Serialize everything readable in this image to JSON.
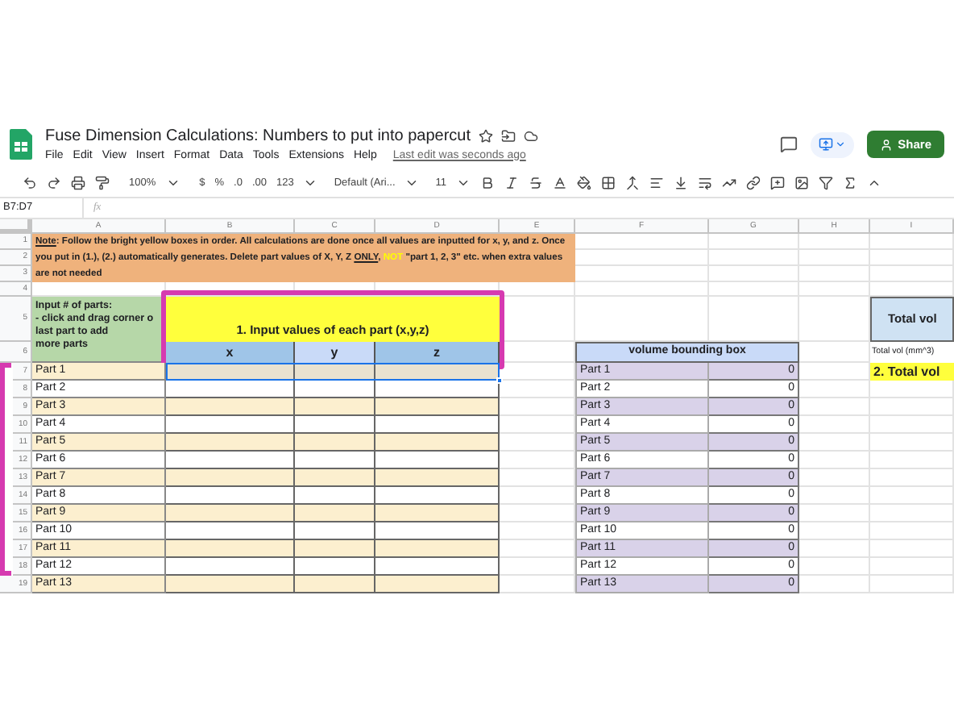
{
  "document": {
    "title": "Fuse Dimension Calculations: Numbers to put into papercut",
    "menus": [
      "File",
      "Edit",
      "View",
      "Insert",
      "Format",
      "Data",
      "Tools",
      "Extensions",
      "Help"
    ],
    "last_edit": "Last edit was seconds ago",
    "share": "Share"
  },
  "toolbar": {
    "zoom": "100%",
    "currency": "$",
    "percent": "%",
    "decrease_decimal": ".0",
    "increase_decimal": ".00",
    "number_format": "123",
    "font": "Default (Ari...",
    "font_size": "11"
  },
  "formula_bar": {
    "name_box": "B7:D7",
    "fx": "fx"
  },
  "columns": [
    "A",
    "B",
    "C",
    "D",
    "E",
    "F",
    "G",
    "H",
    "I"
  ],
  "row_numbers": [
    "1",
    "2",
    "3",
    "4",
    "5",
    "6",
    "7",
    "8",
    "9",
    "10",
    "11",
    "12",
    "13",
    "14",
    "15",
    "16",
    "17",
    "18",
    "19"
  ],
  "note": [
    {
      "kind": "underline",
      "text": "Note"
    },
    {
      "kind": "plain",
      "text": ": Follow the bright yellow boxes in order. All calculations are done once all values are inputted for x, y, and z. Once you put in (1.), (2.) automatically generates. Delete part values of X, Y, Z "
    },
    {
      "kind": "underline",
      "text": "ONLY"
    },
    {
      "kind": "plain",
      "text": ", "
    },
    {
      "kind": "highlight",
      "text": "NOT"
    },
    {
      "kind": "plain",
      "text": " \"part 1, 2, 3\" etc. when extra values are not needed"
    }
  ],
  "parts_instructions": [
    "Input # of parts:",
    "- click and drag corner o",
    "last part to add",
    "more parts"
  ],
  "input_table": {
    "title": "1. Input values of each part (x,y,z)",
    "headers": [
      "x",
      "y",
      "z"
    ]
  },
  "parts": [
    "Part 1",
    "Part 2",
    "Part 3",
    "Part 4",
    "Part 5",
    "Part 6",
    "Part 7",
    "Part 8",
    "Part 9",
    "Part 10",
    "Part 11",
    "Part 12",
    "Part 13"
  ],
  "volume_table": {
    "title": "volume bounding box",
    "rows": [
      {
        "part": "Part 1",
        "value": "0"
      },
      {
        "part": "Part 2",
        "value": "0"
      },
      {
        "part": "Part 3",
        "value": "0"
      },
      {
        "part": "Part 4",
        "value": "0"
      },
      {
        "part": "Part 5",
        "value": "0"
      },
      {
        "part": "Part 6",
        "value": "0"
      },
      {
        "part": "Part 7",
        "value": "0"
      },
      {
        "part": "Part 8",
        "value": "0"
      },
      {
        "part": "Part 9",
        "value": "0"
      },
      {
        "part": "Part 10",
        "value": "0"
      },
      {
        "part": "Part 11",
        "value": "0"
      },
      {
        "part": "Part 12",
        "value": "0"
      },
      {
        "part": "Part 13",
        "value": "0"
      }
    ]
  },
  "total": {
    "title": "Total vol",
    "label": "Total vol (mm^3)",
    "result": "2. Total vol"
  }
}
